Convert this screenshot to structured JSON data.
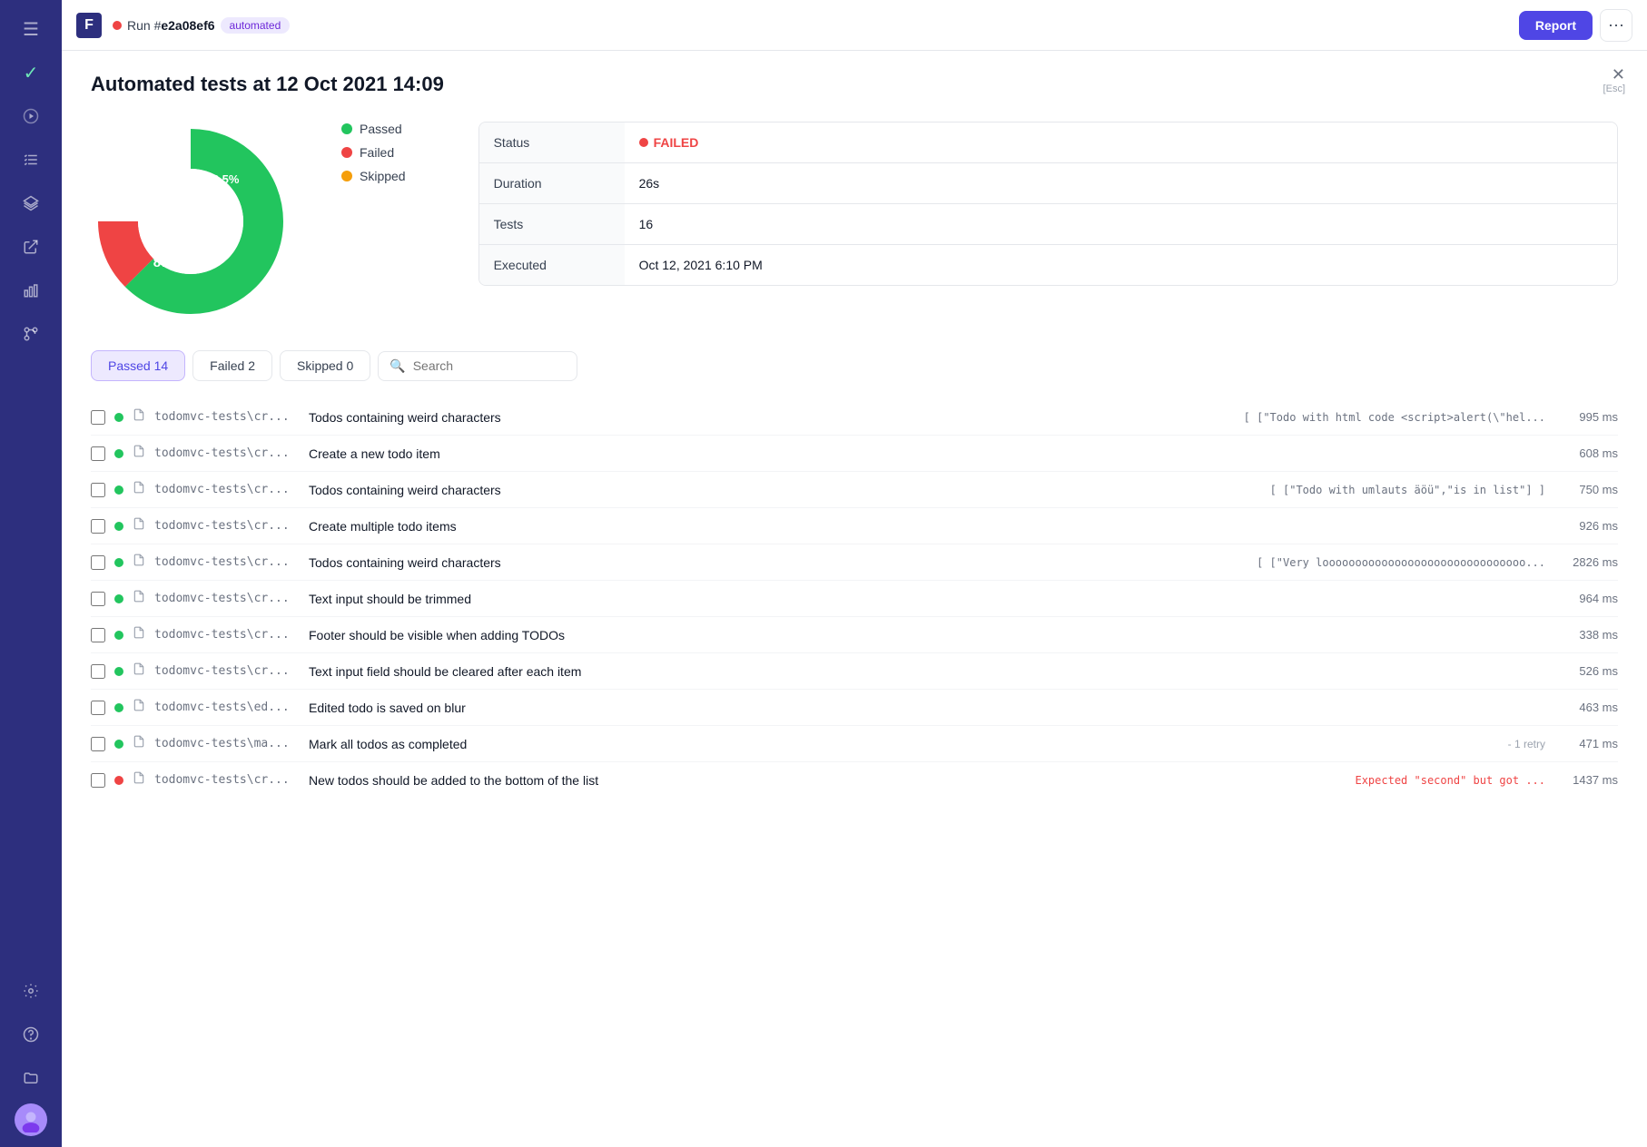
{
  "sidebar": {
    "items": [
      {
        "name": "menu",
        "icon": "☰"
      },
      {
        "name": "check",
        "icon": "✓"
      },
      {
        "name": "play",
        "icon": "▶"
      },
      {
        "name": "list-check",
        "icon": "≡✓"
      },
      {
        "name": "layers",
        "icon": "◈"
      },
      {
        "name": "export",
        "icon": "⬛→"
      },
      {
        "name": "chart",
        "icon": "📊"
      },
      {
        "name": "git",
        "icon": "⎇"
      },
      {
        "name": "settings",
        "icon": "⚙"
      },
      {
        "name": "help",
        "icon": "?"
      },
      {
        "name": "folder",
        "icon": "📁"
      }
    ]
  },
  "topbar": {
    "run_indicator": "Run #",
    "run_id": "e2a08ef6",
    "badge": "automated",
    "report_btn": "Report",
    "more_btn": "···"
  },
  "page": {
    "title": "Automated tests at 12 Oct 2021 14:09",
    "close_key": "[Esc]"
  },
  "chart": {
    "passed_pct": 87.5,
    "failed_pct": 12.5,
    "passed_label": "87.5%",
    "failed_label": "12.5%",
    "legend": [
      {
        "label": "Passed",
        "color": "#22c55e"
      },
      {
        "label": "Failed",
        "color": "#ef4444"
      },
      {
        "label": "Skipped",
        "color": "#f59e0b"
      }
    ]
  },
  "status_table": {
    "rows": [
      {
        "label": "Status",
        "value": "FAILED",
        "type": "failed"
      },
      {
        "label": "Duration",
        "value": "26s"
      },
      {
        "label": "Tests",
        "value": "16"
      },
      {
        "label": "Executed",
        "value": "Oct 12, 2021 6:10 PM"
      }
    ]
  },
  "filters": {
    "passed": {
      "label": "Passed",
      "count": "14"
    },
    "failed": {
      "label": "Failed",
      "count": "2"
    },
    "skipped": {
      "label": "Skipped",
      "count": "0"
    },
    "search_placeholder": "Search"
  },
  "tests": [
    {
      "status": "passed",
      "file": "todomvc-tests\\cr...",
      "name": "Todos containing weird characters",
      "detail": "[ [\"Todo with html code <script>alert(\\\"hel...",
      "duration": "995 ms",
      "retry": ""
    },
    {
      "status": "passed",
      "file": "todomvc-tests\\cr...",
      "name": "Create a new todo item",
      "detail": "",
      "duration": "608 ms",
      "retry": ""
    },
    {
      "status": "passed",
      "file": "todomvc-tests\\cr...",
      "name": "Todos containing weird characters",
      "detail": "[ [\"Todo with umlauts äöü\",\"is in list\"] ]",
      "duration": "750 ms",
      "retry": ""
    },
    {
      "status": "passed",
      "file": "todomvc-tests\\cr...",
      "name": "Create multiple todo items",
      "detail": "",
      "duration": "926 ms",
      "retry": ""
    },
    {
      "status": "passed",
      "file": "todomvc-tests\\cr...",
      "name": "Todos containing weird characters",
      "detail": "[ [\"Very looooooooooooooooooooooooooooooo...",
      "duration": "2826 ms",
      "retry": ""
    },
    {
      "status": "passed",
      "file": "todomvc-tests\\cr...",
      "name": "Text input should be trimmed",
      "detail": "",
      "duration": "964 ms",
      "retry": ""
    },
    {
      "status": "passed",
      "file": "todomvc-tests\\cr...",
      "name": "Footer should be visible when adding TODOs",
      "detail": "",
      "duration": "338 ms",
      "retry": ""
    },
    {
      "status": "passed",
      "file": "todomvc-tests\\cr...",
      "name": "Text input field should be cleared after each item",
      "detail": "",
      "duration": "526 ms",
      "retry": ""
    },
    {
      "status": "passed",
      "file": "todomvc-tests\\ed...",
      "name": "Edited todo is saved on blur",
      "detail": "",
      "duration": "463 ms",
      "retry": ""
    },
    {
      "status": "passed",
      "file": "todomvc-tests\\ma...",
      "name": "Mark all todos as completed",
      "detail": "- 1 retry",
      "duration": "471 ms",
      "retry": "- 1 retry"
    },
    {
      "status": "failed",
      "file": "todomvc-tests\\cr...",
      "name": "New todos should be added to the bottom of the list",
      "detail": "Expected \"second\" but got ...",
      "duration": "1437 ms",
      "retry": ""
    }
  ]
}
